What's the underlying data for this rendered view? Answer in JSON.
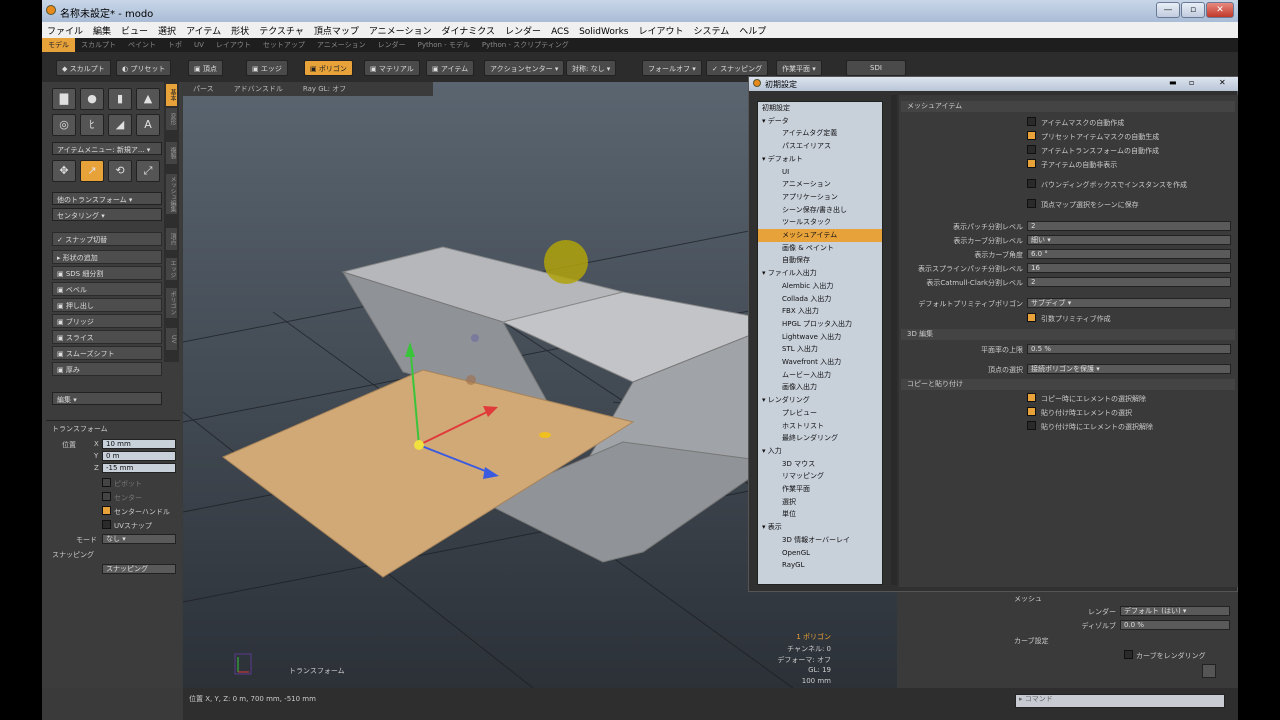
{
  "window": {
    "title": "名称未設定* - modo",
    "min": "—",
    "max": "▫",
    "close": "✕"
  },
  "menubar": [
    "ファイル",
    "編集",
    "ビュー",
    "選択",
    "アイテム",
    "形状",
    "テクスチャ",
    "頂点マップ",
    "アニメーション",
    "ダイナミクス",
    "レンダー",
    "ACS",
    "SolidWorks",
    "レイアウト",
    "システム",
    "ヘルプ"
  ],
  "tabs": [
    {
      "label": "モデル",
      "active": true
    },
    {
      "label": "スカルプト",
      "active": false
    },
    {
      "label": "ペイント",
      "active": false
    },
    {
      "label": "トポ",
      "active": false
    },
    {
      "label": "UV",
      "active": false
    },
    {
      "label": "レイアウト",
      "active": false
    },
    {
      "label": "セットアップ",
      "active": false
    },
    {
      "label": "アニメーション",
      "active": false
    },
    {
      "label": "レンダー",
      "active": false
    },
    {
      "label": "Python - モデル",
      "active": false
    },
    {
      "label": "Python - スクリプティング",
      "active": false
    }
  ],
  "toolbar": {
    "sculpt": "スカルプト",
    "preset": "プリセット",
    "vertex": "頂点",
    "edge": "エッジ",
    "polygon": "ポリゴン",
    "material": "マテリアル",
    "item": "アイテム",
    "action_center": "アクションセンター ▾",
    "symmetry": "対称: なし ▾",
    "falloff": "フォールオフ ▾",
    "snapping": "スナッピング",
    "work_plane": "作業平面 ▾",
    "sdi": "SDI"
  },
  "left": {
    "vtabs": [
      "基本",
      "変形",
      "複製",
      "メッシュ編集",
      "頂点",
      "エッジ",
      "ポリゴン",
      "UV"
    ],
    "item_menu": "アイテムメニュー: 新規ア... ▾",
    "transform_drop": "他のトランスフォーム ▾",
    "center_drop": "センタリング ▾",
    "snap_toggle": "スナップ切替",
    "add_shape": "形状の追加",
    "tools": [
      "SDS 細分割",
      "ベベル",
      "押し出し",
      "ブリッジ",
      "スライス",
      "スムーズシフト",
      "厚み"
    ],
    "edit_drop": "編集 ▾",
    "transform_header": "トランスフォーム",
    "pos_label": "位置",
    "x": "10 mm",
    "y": "0 m",
    "z": "-15 mm",
    "pivot": "ピボット",
    "center": "センター",
    "center_handle": "センターハンドル",
    "uv_snap": "UVスナップ",
    "mode_label": "モード",
    "mode_value": "なし ▾",
    "snapping_header": "スナッピング",
    "snapping_btn": "スナッピング"
  },
  "viewport": {
    "tabs": [
      "パース",
      "アドバンスドル",
      "Ray GL: オフ"
    ],
    "label": "トランスフォーム",
    "hud": [
      "1 ポリゴン",
      "チャンネル: 0",
      "デフォーマ: オフ",
      "GL: 19",
      "100 mm"
    ]
  },
  "status": {
    "position": "位置 X, Y, Z:  0 m, 700 mm, -510 mm"
  },
  "dialog": {
    "title": "初期設定",
    "tree": [
      {
        "label": "初期設定",
        "level": 0,
        "sel": false
      },
      {
        "label": "▾ データ",
        "level": 0,
        "sel": false
      },
      {
        "label": "アイテムタグ定義",
        "level": 2,
        "sel": false
      },
      {
        "label": "パスエイリアス",
        "level": 2,
        "sel": false
      },
      {
        "label": "▾ デフォルト",
        "level": 0,
        "sel": false
      },
      {
        "label": "UI",
        "level": 2,
        "sel": false
      },
      {
        "label": "アニメーション",
        "level": 2,
        "sel": false
      },
      {
        "label": "アプリケーション",
        "level": 2,
        "sel": false
      },
      {
        "label": "シーン保存/書き出し",
        "level": 2,
        "sel": false
      },
      {
        "label": "ツールスタック",
        "level": 2,
        "sel": false
      },
      {
        "label": "メッシュアイテム",
        "level": 2,
        "sel": true
      },
      {
        "label": "画像 & ペイント",
        "level": 2,
        "sel": false
      },
      {
        "label": "自動保存",
        "level": 2,
        "sel": false
      },
      {
        "label": "▾ ファイル入出力",
        "level": 0,
        "sel": false
      },
      {
        "label": "Alembic 入出力",
        "level": 2,
        "sel": false
      },
      {
        "label": "Collada 入出力",
        "level": 2,
        "sel": false
      },
      {
        "label": "FBX 入出力",
        "level": 2,
        "sel": false
      },
      {
        "label": "HPGL プロッタ入出力",
        "level": 2,
        "sel": false
      },
      {
        "label": "Lightwave 入出力",
        "level": 2,
        "sel": false
      },
      {
        "label": "STL 入出力",
        "level": 2,
        "sel": false
      },
      {
        "label": "Wavefront 入出力",
        "level": 2,
        "sel": false
      },
      {
        "label": "ムービー入出力",
        "level": 2,
        "sel": false
      },
      {
        "label": "画像入出力",
        "level": 2,
        "sel": false
      },
      {
        "label": "▾ レンダリング",
        "level": 0,
        "sel": false
      },
      {
        "label": "プレビュー",
        "level": 2,
        "sel": false
      },
      {
        "label": "ホストリスト",
        "level": 2,
        "sel": false
      },
      {
        "label": "最終レンダリング",
        "level": 2,
        "sel": false
      },
      {
        "label": "▾ 入力",
        "level": 0,
        "sel": false
      },
      {
        "label": "3D マウス",
        "level": 2,
        "sel": false
      },
      {
        "label": "リマッピング",
        "level": 2,
        "sel": false
      },
      {
        "label": "作業平面",
        "level": 2,
        "sel": false
      },
      {
        "label": "選択",
        "level": 2,
        "sel": false
      },
      {
        "label": "単位",
        "level": 2,
        "sel": false
      },
      {
        "label": "▾ 表示",
        "level": 0,
        "sel": false
      },
      {
        "label": "3D 情報オーバーレイ",
        "level": 2,
        "sel": false
      },
      {
        "label": "OpenGL",
        "level": 2,
        "sel": false
      },
      {
        "label": "RayGL",
        "level": 2,
        "sel": false
      }
    ],
    "sec_mesh": "メッシュアイテム",
    "checks": [
      {
        "label": "アイテムマスクの自動作成",
        "on": false
      },
      {
        "label": "プリセットアイテムマスクの自動生成",
        "on": true
      },
      {
        "label": "アイテムトランスフォームの自動作成",
        "on": false
      },
      {
        "label": "子アイテムの自動非表示",
        "on": true
      },
      {
        "label": "バウンディングボックスでインスタンスを作成",
        "on": false
      },
      {
        "label": "頂点マップ選択をシーンに保存",
        "on": false
      }
    ],
    "fields": [
      {
        "label": "表示パッチ分割レベル",
        "value": "2"
      },
      {
        "label": "表示カーブ分割レベル",
        "value": "細い ▾"
      },
      {
        "label": "表示カーブ角度",
        "value": "6.0 °"
      },
      {
        "label": "表示スプラインパッチ分割レベル",
        "value": "16"
      },
      {
        "label": "表示Catmull-Clark分割レベル",
        "value": "2"
      }
    ],
    "default_prim_label": "デフォルトプリミティブポリゴン",
    "default_prim_value": "サブディブ ▾",
    "poly_cage": "引数プリミティブ作成",
    "sec_3d": "3D 編集",
    "plane_label": "平面率の上限",
    "plane_value": "0.5 %",
    "vsel_label": "頂点の選択",
    "vsel_value": "接続ポリゴンを保護 ▾",
    "sec_copy": "コピーと貼り付け",
    "copy_checks": [
      {
        "label": "コピー時にエレメントの選択解除",
        "on": true
      },
      {
        "label": "貼り付け時エレメントの選択",
        "on": true
      },
      {
        "label": "貼り付け時にエレメントの選択解除",
        "on": false
      }
    ]
  },
  "rpanel": {
    "mesh": "メッシュ",
    "render_label": "レンダー",
    "render_value": "デフォルト (はい) ▾",
    "dissolve_label": "ディゾルブ",
    "dissolve_value": "0.0 %",
    "curve": "カーブ設定",
    "curve_render": "カーブをレンダリング",
    "command": "コマンド"
  }
}
